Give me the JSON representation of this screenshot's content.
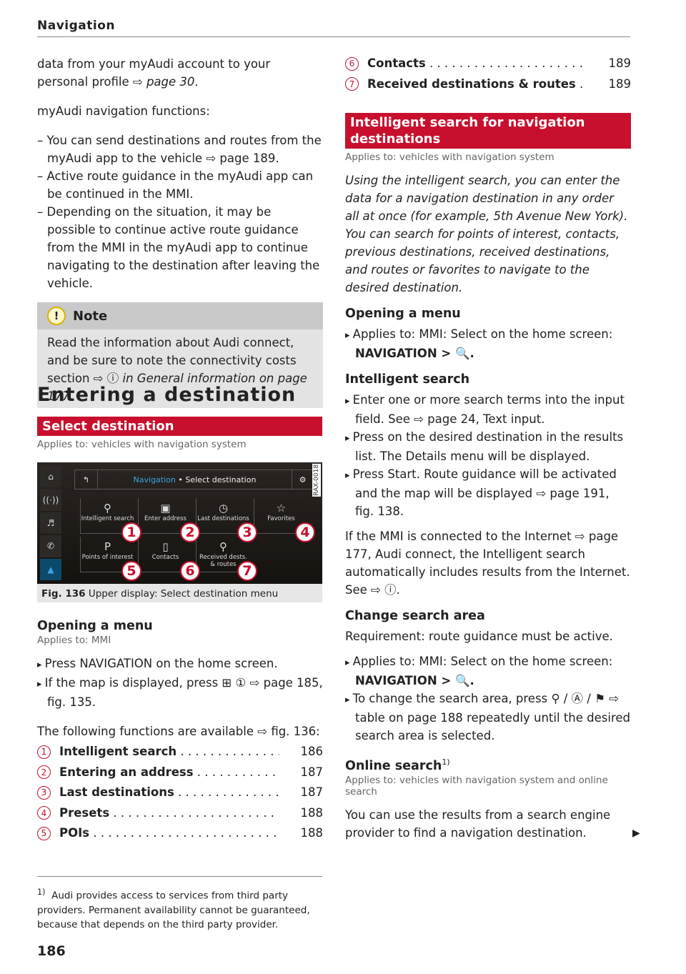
{
  "header": {
    "title": "Navigation"
  },
  "left": {
    "intro": [
      "data from your myAudi account to your personal profile ⇨",
      "page 30",
      "."
    ],
    "functions_title": "myAudi navigation functions:",
    "bullets": [
      "You can send destinations and routes from the myAudi app to the vehicle ⇨ page 189.",
      "Active route guidance in the myAudi app can be continued in the MMI.",
      "Depending on the situation, it may be possible to continue active route guidance from the MMI in the myAudi app to continue navigating to the destination after leaving the vehicle."
    ],
    "note": {
      "icon": "warning-circle-icon",
      "title": "Note",
      "body": "Read the information about Audi connect, and be sure to note the connectivity costs section ⇨",
      "body_link": "in General information on page 177."
    },
    "section_title": "Entering a destination",
    "select_heading": "Select destination",
    "select_applies": "Applies to: vehicles with navigation system",
    "figure": {
      "code": "RAX-0018",
      "title_nav": "Navigation",
      "title_sep": "•",
      "title_page": "Select destination",
      "side_icons": [
        "home-icon",
        "radio-icon",
        "music-icon",
        "phone-icon",
        "navigation-icon"
      ],
      "tiles": [
        {
          "label": "Intelligent search",
          "icon": "search-icon",
          "num": "1"
        },
        {
          "label": "Enter address",
          "icon": "address-card-icon",
          "num": "2"
        },
        {
          "label": "Last destinations",
          "icon": "clock-icon",
          "num": "3"
        },
        {
          "label": "Favorites",
          "icon": "star-icon",
          "num": "4"
        },
        {
          "label": "Points of interest",
          "icon": "poi-icon",
          "num": "5"
        },
        {
          "label": "Contacts",
          "icon": "contacts-icon",
          "num": "6"
        },
        {
          "label": "Received dests. & routes",
          "icon": "pin-icon",
          "num": "7"
        }
      ],
      "caption_num": "Fig. 136",
      "caption": "Upper display: Select destination menu"
    },
    "opening_title": "Opening a menu",
    "opening_applies": "Applies to: MMI",
    "steps": [
      "Press NAVIGATION on the home screen.",
      "If the map is displayed, press ⊞ ① ⇨ page 185, fig. 135."
    ],
    "available": "The following functions are available ⇨ fig. 136:",
    "toc": [
      {
        "num": "1",
        "label": "Intelligent search",
        "page": "186"
      },
      {
        "num": "2",
        "label": "Entering an address",
        "page": "187"
      },
      {
        "num": "3",
        "label": "Last destinations",
        "page": "187"
      },
      {
        "num": "4",
        "label": "Presets",
        "page": "188"
      },
      {
        "num": "5",
        "label": "POIs",
        "page": "188"
      }
    ],
    "footnote_mark": "1)",
    "footnote": "Audi provides access to services from third party providers. Permanent availability cannot be guaranteed, because that depends on the third party provider."
  },
  "right": {
    "toc": [
      {
        "num": "6",
        "label": "Contacts",
        "page": "189"
      },
      {
        "num": "7",
        "label": "Received destinations & routes",
        "page": "189"
      }
    ],
    "heading": "Intelligent search for navigation destinations",
    "applies": "Applies to: vehicles with navigation system",
    "intro": "Using the intelligent search, you can enter the data for a navigation destination in any order all at once (for example, 5th Avenue New York). You can search for points of interest, contacts, previous destinations, received destinations, and routes or favorites to navigate to the desired destination.",
    "opening_title": "Opening a menu",
    "opening_step": "Applies to: MMI: Select on the home screen:",
    "opening_path": "NAVIGATION > 🔍.",
    "is_title": "Intelligent search",
    "is_steps": [
      "Enter one or more search terms into the input field. See ⇨ page 24, Text input.",
      "Press on the desired destination in the results list. The Details menu will be displayed.",
      "Press Start. Route guidance will be activated and the map will be displayed ⇨ page 191, fig. 138."
    ],
    "internet": "If the MMI is connected to the Internet ⇨ page 177, Audi connect, the Intelligent search automatically includes results from the Internet. See ⇨ ⓘ.",
    "csa_title": "Change search area",
    "csa_req": "Requirement: route guidance must be active.",
    "csa_step1": "Applies to: MMI: Select on the home screen:",
    "csa_path": "NAVIGATION > 🔍.",
    "csa_step2": "To change the search area, press ⚲ / Ⓐ / ⚑ ⇨ table on page 188 repeatedly until the desired search area is selected.",
    "os_title": "Online search",
    "os_sup": "1)",
    "os_applies": "Applies to: vehicles with navigation system and online search",
    "os_text": "You can use the results from a search engine provider to find a navigation destination."
  },
  "page_number": "186",
  "colors": {
    "accent": "#c8102e",
    "note_bg": "#e3e3e3"
  }
}
